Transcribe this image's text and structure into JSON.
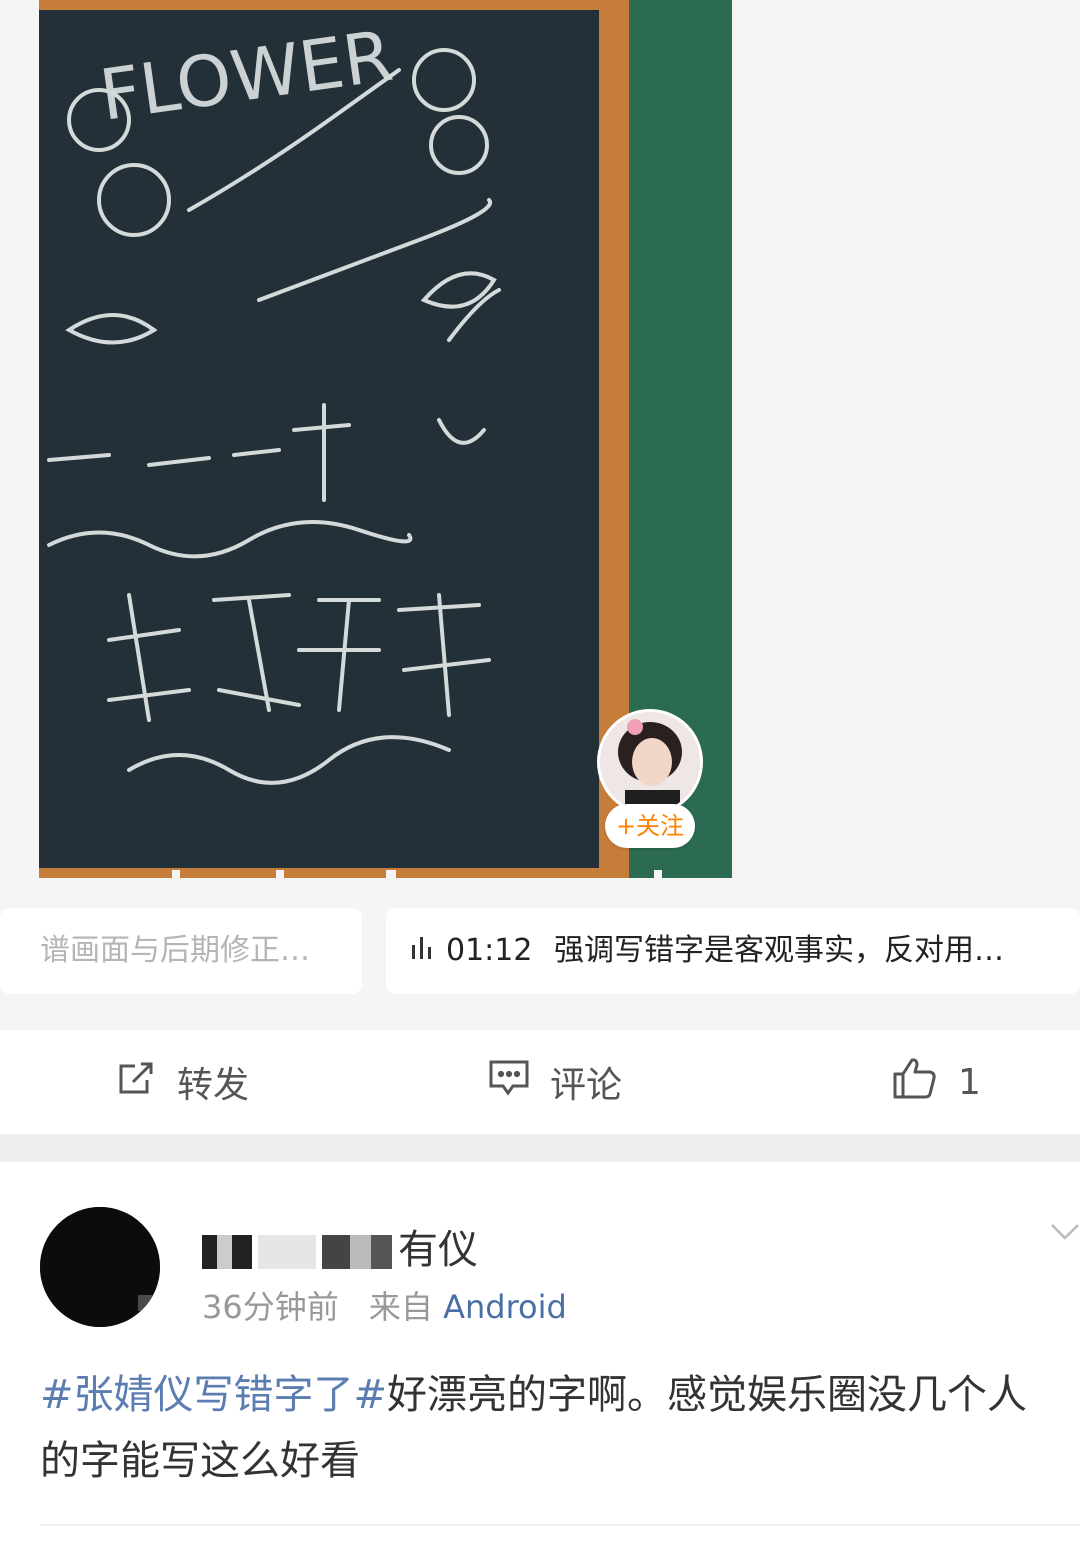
{
  "video": {
    "follow_label": "+关注"
  },
  "chips": {
    "left_text": "谱画面与后期修正…",
    "right_time": "01:12",
    "right_text": "强调写错字是客观事实，反对用…"
  },
  "actions": {
    "repost_label": "转发",
    "comment_label": "评论",
    "like_count": "1"
  },
  "comment": {
    "username_visible": "有仪",
    "time": "36分钟前",
    "source_prefix": "来自",
    "source": "Android",
    "hashtag": "#张婧仪写错字了#",
    "body": "好漂亮的字啊。感觉娱乐圈没几个人的字能写这么好看"
  },
  "colors": {
    "accent_orange": "#ff8200",
    "link_blue": "#5b7db1"
  }
}
